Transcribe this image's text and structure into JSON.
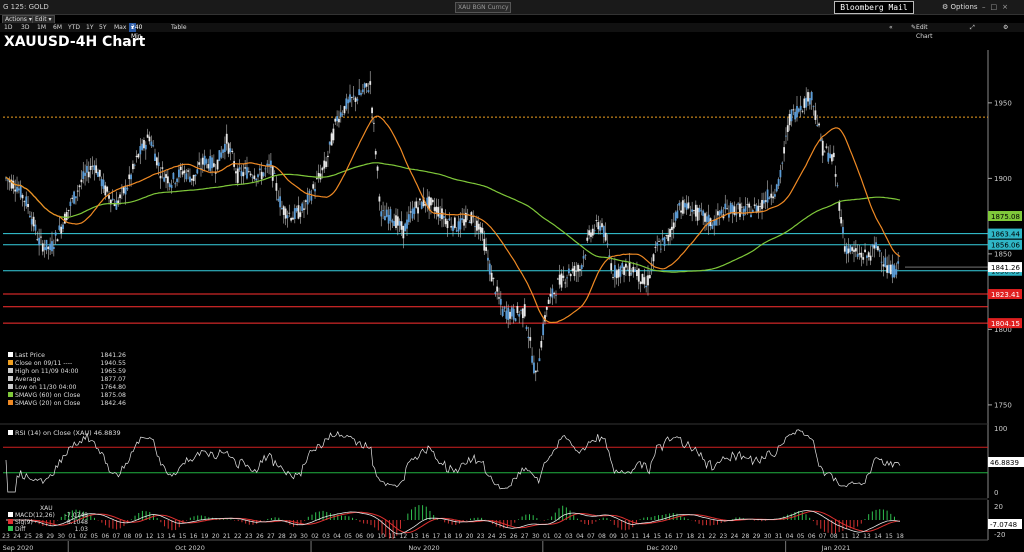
{
  "app": {
    "security": "G 125: GOLD",
    "ticker_field": "XAU BGN Curncy",
    "mail_button": "Bloomberg Mail",
    "options": "Options",
    "actions": "Actions",
    "edit": "Edit",
    "periods": [
      "1D",
      "3D",
      "1M",
      "6M",
      "YTD",
      "1Y",
      "5Y",
      "Max"
    ],
    "interval": "240 Min",
    "table": "Table",
    "edit_chart": "Edit Chart"
  },
  "chart_title": "XAUUSD-4H Chart",
  "legend": {
    "rows": [
      {
        "label": "Last Price",
        "value": "1841.26",
        "color": "#ffffff"
      },
      {
        "label": "Close on 09/11 ----",
        "value": "1940.55",
        "color": "#f0a020"
      },
      {
        "label": "High on 11/09 04:00",
        "value": "1965.59",
        "color": "#cccccc"
      },
      {
        "label": "Average",
        "value": "1877.07",
        "color": "#cccccc"
      },
      {
        "label": "Low on 11/30 04:00",
        "value": "1764.80",
        "color": "#cccccc"
      },
      {
        "label": "SMAVG (60)  on Close",
        "value": "1875.08",
        "color": "#7fc83a"
      },
      {
        "label": "SMAVG (20)  on Close",
        "value": "1842.46",
        "color": "#f08a24"
      }
    ]
  },
  "rsi_label": "RSI (14)  on Close (XAU) 46.8839",
  "macd_legend": {
    "header": "XAU",
    "rows": [
      {
        "label": "MACD(12,26)",
        "value": "-7.0748"
      },
      {
        "label": "Sig(9)",
        "value": "-8.1048"
      },
      {
        "label": "Diff",
        "value": "1.03"
      }
    ]
  },
  "chart_data": {
    "type": "candlestick",
    "title": "XAUUSD-4H Chart",
    "price_axis": {
      "ylim": [
        1740,
        1985
      ],
      "ticks": [
        "1950",
        "1900",
        "1850",
        "1800",
        "1750"
      ]
    },
    "horizontal_levels": [
      {
        "value": 1940.55,
        "color": "#f0a020",
        "style": "dashed"
      },
      {
        "value": 1863.44,
        "color": "#37d0e0",
        "label": "1863.44"
      },
      {
        "value": 1856.06,
        "color": "#37d0e0",
        "label": "1856.06"
      },
      {
        "value": 1838.83,
        "color": "#37d0e0",
        "label": "1838.83"
      },
      {
        "value": 1823.41,
        "color": "#ff3030",
        "label": "1823.41"
      },
      {
        "value": 1815.0,
        "color": "#ff3030"
      },
      {
        "value": 1804.15,
        "color": "#ff3030",
        "label": "1804.15"
      }
    ],
    "price_tags": [
      {
        "value": 1875.08,
        "label": "1875.08",
        "color": "#7fc83a"
      },
      {
        "value": 1841.26,
        "label": "1841.26",
        "color": "#ffffff"
      }
    ],
    "price_path": [
      [
        23,
        1900
      ],
      [
        24,
        1895
      ],
      [
        25,
        1882
      ],
      [
        28,
        1858
      ],
      [
        29,
        1853
      ],
      [
        30,
        1868
      ],
      [
        1,
        1885
      ],
      [
        2,
        1900
      ],
      [
        5,
        1910
      ],
      [
        6,
        1892
      ],
      [
        7,
        1883
      ],
      [
        8,
        1895
      ],
      [
        9,
        1915
      ],
      [
        12,
        1928
      ],
      [
        13,
        1905
      ],
      [
        14,
        1898
      ],
      [
        15,
        1905
      ],
      [
        16,
        1900
      ],
      [
        19,
        1912
      ],
      [
        20,
        1908
      ],
      [
        21,
        1925
      ],
      [
        22,
        1902
      ],
      [
        23,
        1905
      ],
      [
        26,
        1902
      ],
      [
        27,
        1908
      ],
      [
        28,
        1880
      ],
      [
        29,
        1875
      ],
      [
        30,
        1880
      ],
      [
        2,
        1895
      ],
      [
        3,
        1910
      ],
      [
        4,
        1940
      ],
      [
        5,
        1950
      ],
      [
        6,
        1955
      ],
      [
        9,
        1962
      ],
      [
        10,
        1875
      ],
      [
        11,
        1875
      ],
      [
        12,
        1865
      ],
      [
        13,
        1880
      ],
      [
        16,
        1885
      ],
      [
        17,
        1880
      ],
      [
        18,
        1872
      ],
      [
        19,
        1868
      ],
      [
        20,
        1875
      ],
      [
        23,
        1868
      ],
      [
        24,
        1835
      ],
      [
        25,
        1812
      ],
      [
        26,
        1810
      ],
      [
        27,
        1812
      ],
      [
        30,
        1768
      ],
      [
        1,
        1815
      ],
      [
        2,
        1830
      ],
      [
        3,
        1838
      ],
      [
        4,
        1840
      ],
      [
        7,
        1865
      ],
      [
        8,
        1870
      ],
      [
        9,
        1838
      ],
      [
        10,
        1840
      ],
      [
        11,
        1840
      ],
      [
        14,
        1828
      ],
      [
        15,
        1855
      ],
      [
        16,
        1860
      ],
      [
        17,
        1882
      ],
      [
        18,
        1880
      ],
      [
        21,
        1875
      ],
      [
        22,
        1870
      ],
      [
        23,
        1878
      ],
      [
        24,
        1880
      ],
      [
        28,
        1878
      ],
      [
        29,
        1880
      ],
      [
        30,
        1888
      ],
      [
        31,
        1895
      ],
      [
        4,
        1940
      ],
      [
        5,
        1948
      ],
      [
        6,
        1955
      ],
      [
        7,
        1920
      ],
      [
        8,
        1912
      ],
      [
        11,
        1855
      ],
      [
        12,
        1850
      ],
      [
        13,
        1848
      ],
      [
        14,
        1855
      ],
      [
        15,
        1838
      ],
      [
        18,
        1841
      ]
    ],
    "smavg_60": {
      "name": "SMAVG (60)  on Close",
      "last": 1875.08
    },
    "smavg_20": {
      "name": "SMAVG (20)  on Close",
      "last": 1842.46
    },
    "rsi": {
      "ylim": [
        0,
        100
      ],
      "ticks": [
        "100",
        "0"
      ],
      "levels": [
        70,
        30
      ],
      "last": "46.8839"
    },
    "macd": {
      "ticks": [
        "20",
        "-20"
      ],
      "last": "-7.0748"
    },
    "x_axis": {
      "day_ticks": [
        "23",
        "24",
        "25",
        "28",
        "29",
        "30",
        "01",
        "02",
        "05",
        "06",
        "07",
        "08",
        "09",
        "12",
        "13",
        "14",
        "15",
        "16",
        "19",
        "20",
        "21",
        "22",
        "23",
        "26",
        "27",
        "28",
        "29",
        "30",
        "02",
        "03",
        "04",
        "05",
        "06",
        "09",
        "10",
        "11",
        "12",
        "13",
        "16",
        "17",
        "18",
        "19",
        "20",
        "23",
        "24",
        "25",
        "26",
        "27",
        "30",
        "01",
        "02",
        "03",
        "04",
        "07",
        "08",
        "09",
        "10",
        "11",
        "14",
        "15",
        "16",
        "17",
        "18",
        "21",
        "22",
        "23",
        "24",
        "28",
        "29",
        "30",
        "31",
        "04",
        "05",
        "06",
        "07",
        "08",
        "11",
        "12",
        "13",
        "14",
        "15",
        "18"
      ],
      "month_labels": [
        "Sep 2020",
        "Oct 2020",
        "Nov 2020",
        "Dec 2020",
        "Jan 2021"
      ]
    }
  }
}
